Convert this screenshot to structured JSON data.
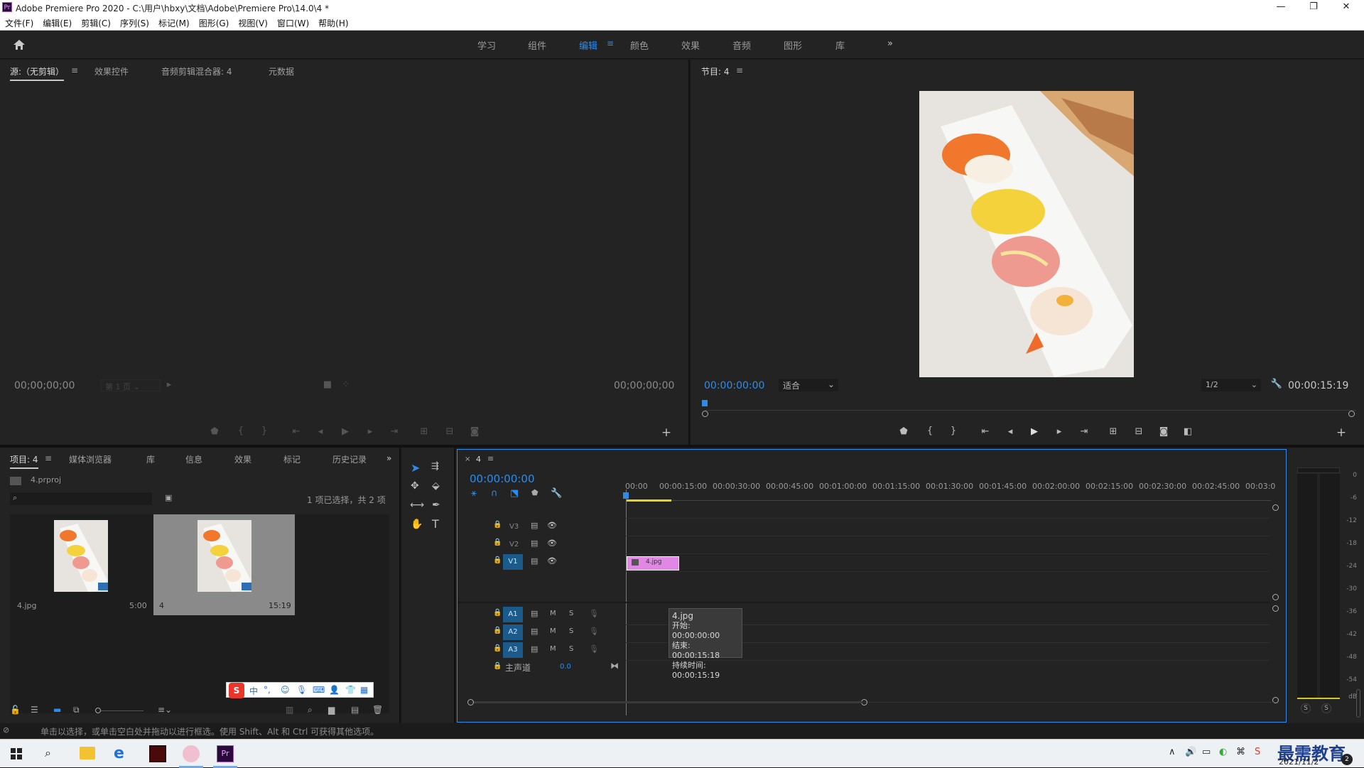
{
  "window": {
    "title": "Adobe Premiere Pro 2020 - C:\\用户\\hbxy\\文档\\Adobe\\Premiere Pro\\14.0\\4 *",
    "app_icon": "Pr",
    "minimize": "—",
    "maximize": "❐",
    "close": "✕"
  },
  "menu": [
    "文件(F)",
    "编辑(E)",
    "剪辑(C)",
    "序列(S)",
    "标记(M)",
    "图形(G)",
    "视图(V)",
    "窗口(W)",
    "帮助(H)"
  ],
  "workspaces": {
    "tabs": [
      "学习",
      "组件",
      "编辑",
      "颜色",
      "效果",
      "音频",
      "图形",
      "库"
    ],
    "active": "编辑",
    "more": "»"
  },
  "source_panel": {
    "tabs": [
      "源:（无剪辑）",
      "效果控件",
      "音频剪辑混合器: 4",
      "元数据"
    ],
    "timecode_left": "00;00;00;00",
    "page_select": "第 1 页",
    "timecode_right": "00;00;00;00"
  },
  "program_panel": {
    "title": "节目: 4",
    "timecode": "00:00:00:00",
    "fit": "适合",
    "resolution": "1/2",
    "duration": "00:00:15:19"
  },
  "project_panel": {
    "tabs": [
      "项目: 4",
      "媒体浏览器",
      "库",
      "信息",
      "效果",
      "标记",
      "历史记录"
    ],
    "project_file": "4.prproj",
    "selection_info": "1 项已选择，共 2 项",
    "items": [
      {
        "name": "4.jpg",
        "duration": "5:00"
      },
      {
        "name": "4",
        "duration": "15:19"
      }
    ]
  },
  "timeline": {
    "sequence_name": "4",
    "timecode": "00:00:00:00",
    "ruler": [
      "00:00",
      "00:00:15:00",
      "00:00:30:00",
      "00:00:45:00",
      "00:01:00:00",
      "00:01:15:00",
      "00:01:30:00",
      "00:01:45:00",
      "00:02:00:00",
      "00:02:15:00",
      "00:02:30:00",
      "00:02:45:00",
      "00:03:0"
    ],
    "video_tracks": [
      "V3",
      "V2",
      "V1"
    ],
    "audio_tracks": [
      "A1",
      "A2",
      "A3"
    ],
    "master": {
      "label": "主声道",
      "value": "0.0"
    },
    "clip": {
      "name": "4.jpg"
    },
    "tooltip": {
      "name": "4.jpg",
      "start": "开始: 00:00:00:00",
      "end": "结束: 00:00:15:18",
      "duration": "持续时间: 00:00:15:19"
    }
  },
  "meter": {
    "labels": [
      "0",
      "-6",
      "-12",
      "-18",
      "-24",
      "-30",
      "-36",
      "-42",
      "-48",
      "-54",
      "dB"
    ],
    "solo_left": "S",
    "solo_right": "S"
  },
  "status_text": "单击以选择，或单击空白处并拖动以进行框选。使用 Shift、Alt 和 Ctrl 可获得其他选项。",
  "ime_toolbar": {
    "logo": "S",
    "mode": "中"
  },
  "taskbar": {
    "date": "2021/11/2",
    "watermark": "最需教育",
    "notification_count": "2"
  },
  "colors": {
    "accent": "#2d8ceb",
    "clip": "#e387e6",
    "track_button": "#1b5b8c"
  }
}
